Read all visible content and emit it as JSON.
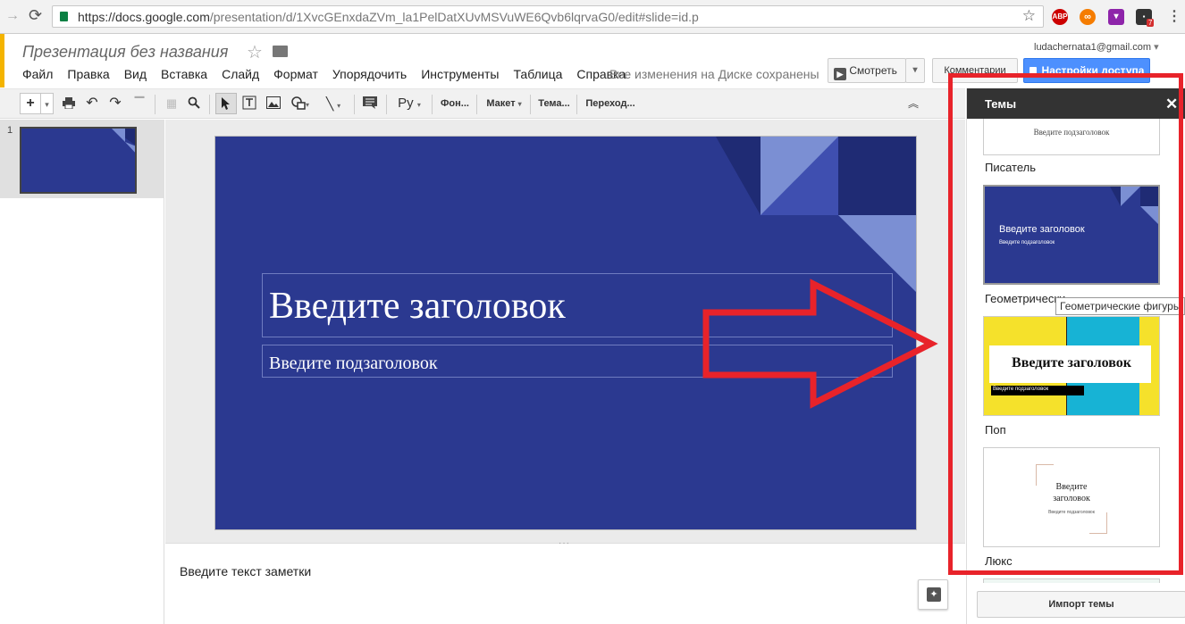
{
  "browser": {
    "url_host": "https://docs.google.com",
    "url_path": "/presentation/d/1XvcGEnxdaZVm_la1PelDatXUvMSVuWE6Qvb6lqrvaG0/edit#slide=id.p",
    "ext_abp": "ABP",
    "ext_badge": "7"
  },
  "header": {
    "doc_title": "Презентация без названия",
    "email": "ludachernata1@gmail.com",
    "menu": [
      "Файл",
      "Правка",
      "Вид",
      "Вставка",
      "Слайд",
      "Формат",
      "Упорядочить",
      "Инструменты",
      "Таблица",
      "Справка"
    ],
    "save_status": "Все изменения на Диске сохранены",
    "present_label": "Смотреть",
    "comments_label": "Комментарии",
    "share_label": "Настройки доступа"
  },
  "toolbar": {
    "lang": "Ру",
    "background": "Фон...",
    "layout": "Макет",
    "theme": "Тема...",
    "transition": "Переход..."
  },
  "filmstrip": {
    "slide_number": "1"
  },
  "slide": {
    "title": "Введите заголовок",
    "subtitle": "Введите подзаголовок"
  },
  "notes": {
    "placeholder": "Введите текст заметки"
  },
  "themes_panel": {
    "title": "Темы",
    "themes": [
      {
        "name": "Писатель",
        "preview_sub": "Введите подзаголовок"
      },
      {
        "name": "Геометрические фигуры",
        "preview_title": "Введите заголовок",
        "preview_sub": "Введите подзаголовок"
      },
      {
        "name": "Поп",
        "preview_title": "Введите заголовок",
        "preview_sub": "Введите подзаголовок"
      },
      {
        "name": "Люкс",
        "preview_title": "Введите заголовок",
        "preview_sub": "Введите подзаголовок"
      }
    ],
    "visible_label_geometric": "Геометрически",
    "tooltip": "Геометрические фигуры",
    "import_label": "Импорт темы"
  },
  "colors": {
    "slide_bg": "#2b3990",
    "highlight": "#e8232a",
    "share_button": "#4d90fe",
    "pop_yellow": "#f5e12b",
    "pop_cyan": "#17b3d5"
  }
}
